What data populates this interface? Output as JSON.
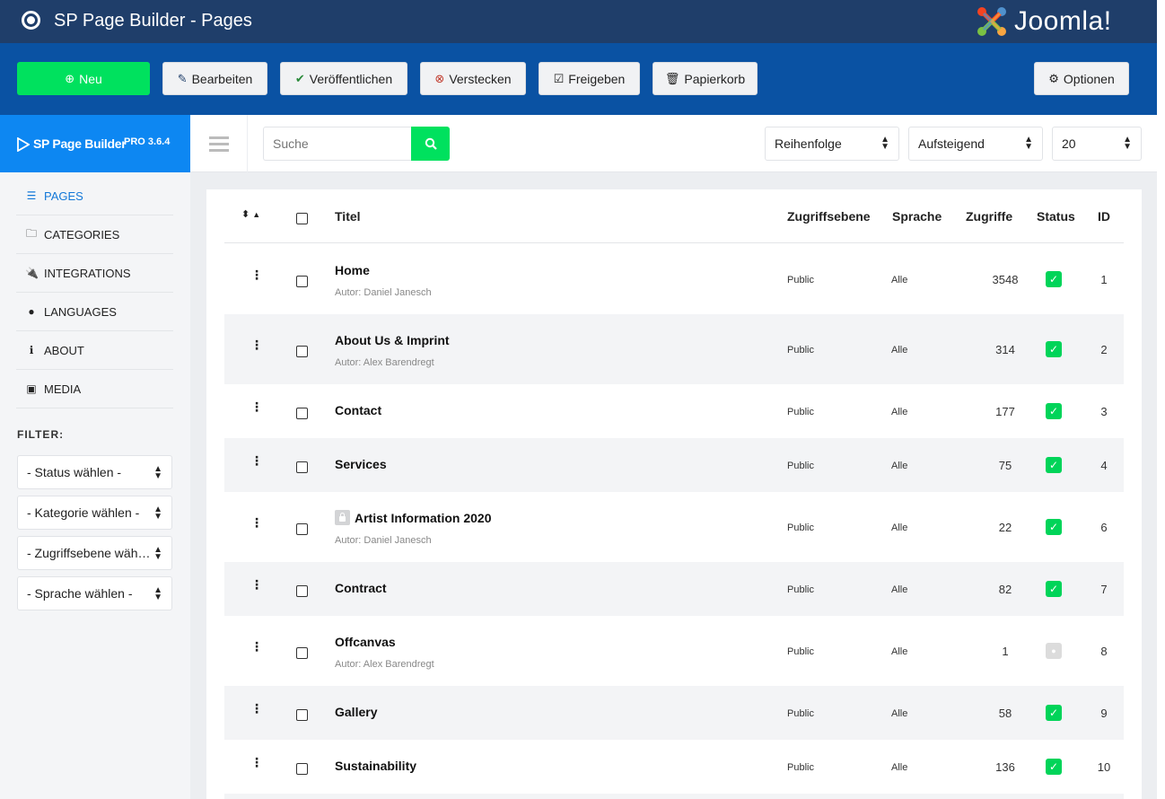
{
  "header": {
    "title": "SP Page Builder - Pages",
    "brand": "Joomla!"
  },
  "toolbar": {
    "new": "Neu",
    "edit": "Bearbeiten",
    "publish": "Veröffentlichen",
    "unpublish": "Verstecken",
    "checkin": "Freigeben",
    "trash": "Papierkorb",
    "options": "Optionen"
  },
  "brand_panel": {
    "name": "SP Page Builder",
    "version": "PRO 3.6.4"
  },
  "search": {
    "placeholder": "Suche"
  },
  "list_controls": {
    "order_by": "Reihenfolge",
    "direction": "Aufsteigend",
    "limit": "20"
  },
  "sidebar": {
    "items": [
      {
        "label": "PAGES",
        "icon": "list-icon"
      },
      {
        "label": "CATEGORIES",
        "icon": "folder-icon"
      },
      {
        "label": "INTEGRATIONS",
        "icon": "plug-icon"
      },
      {
        "label": "LANGUAGES",
        "icon": "globe-icon"
      },
      {
        "label": "ABOUT",
        "icon": "info-icon"
      },
      {
        "label": "MEDIA",
        "icon": "image-icon"
      }
    ],
    "filter_label": "FILTER:",
    "filters": [
      "- Status wählen -",
      "- Kategorie wählen -",
      "- Zugriffsebene wäh…",
      "- Sprache wählen -"
    ]
  },
  "table": {
    "columns": {
      "title": "Titel",
      "access": "Zugriffsebene",
      "language": "Sprache",
      "hits": "Zugriffe",
      "status": "Status",
      "id": "ID"
    },
    "rows": [
      {
        "title": "Home",
        "author": "Autor: Daniel Janesch",
        "access": "Public",
        "language": "Alle",
        "hits": "3548",
        "published": true,
        "id": "1",
        "locked": false
      },
      {
        "title": "About Us & Imprint",
        "author": "Autor: Alex Barendregt",
        "access": "Public",
        "language": "Alle",
        "hits": "314",
        "published": true,
        "id": "2",
        "locked": false
      },
      {
        "title": "Contact",
        "author": "",
        "access": "Public",
        "language": "Alle",
        "hits": "177",
        "published": true,
        "id": "3",
        "locked": false
      },
      {
        "title": "Services",
        "author": "",
        "access": "Public",
        "language": "Alle",
        "hits": "75",
        "published": true,
        "id": "4",
        "locked": false
      },
      {
        "title": "Artist Information 2020",
        "author": "Autor: Daniel Janesch",
        "access": "Public",
        "language": "Alle",
        "hits": "22",
        "published": true,
        "id": "6",
        "locked": true
      },
      {
        "title": "Contract",
        "author": "",
        "access": "Public",
        "language": "Alle",
        "hits": "82",
        "published": true,
        "id": "7",
        "locked": false
      },
      {
        "title": "Offcanvas",
        "author": "Autor: Alex Barendregt",
        "access": "Public",
        "language": "Alle",
        "hits": "1",
        "published": false,
        "id": "8",
        "locked": false
      },
      {
        "title": "Gallery",
        "author": "",
        "access": "Public",
        "language": "Alle",
        "hits": "58",
        "published": true,
        "id": "9",
        "locked": false
      },
      {
        "title": "Sustainability",
        "author": "",
        "access": "Public",
        "language": "Alle",
        "hits": "136",
        "published": true,
        "id": "10",
        "locked": false
      }
    ]
  }
}
